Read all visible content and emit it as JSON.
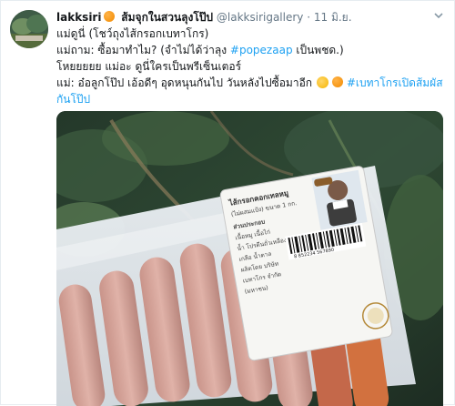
{
  "tweet": {
    "author_name": "lakksiri",
    "author_suffix": "ส้มจุกในสวนลุงโป๊ป",
    "handle": "@lakksirigallery",
    "separator": "·",
    "date": "11 มิ.ย.",
    "lines": {
      "l1": "แม่ดูนี่ (โชว์ถุงไส้กรอกเบทาโกร)",
      "l2_pre": "แม่ถาม: ซื้อมาทำไม? (จำไม่ได้ว่าลุง ",
      "l2_tag": "#popezaap",
      "l2_post": " เป็นพชด.)",
      "l3": "โหยยยยย แม่อะ ดูนี่ใครเป็นพรีเซ็นเตอร์",
      "l4_pre": "แม่: อ๋อลูกโป๊ป  เอ้อดีๆ อุดหนุนกันไป วันหลังไปซื้อมาอีก ",
      "l4_tag": "#เบทาโกรเปิดส้มผัส",
      "l5_tag": "กันโป๊ป"
    }
  },
  "media": {
    "package_brand_text": "ไส้กรอกคอกเทลหมู",
    "package_lines": [
      "(ไม่ผสมแป้ง) ขนาด 1 กก.",
      "ส่วนประกอบ",
      "เนื้อหมู เนื้อไก่",
      "น้ำ โปรตีนถั่วเหลือง",
      "เกลือ น้ำตาล",
      "ผลิตโดย บริษัท",
      "เบทาโกร จำกัด",
      "(มหาชน)"
    ],
    "barcode_number": "8 852234 567890"
  },
  "colors": {
    "link": "#1da1f2",
    "text": "#14171a",
    "muted": "#657786"
  }
}
